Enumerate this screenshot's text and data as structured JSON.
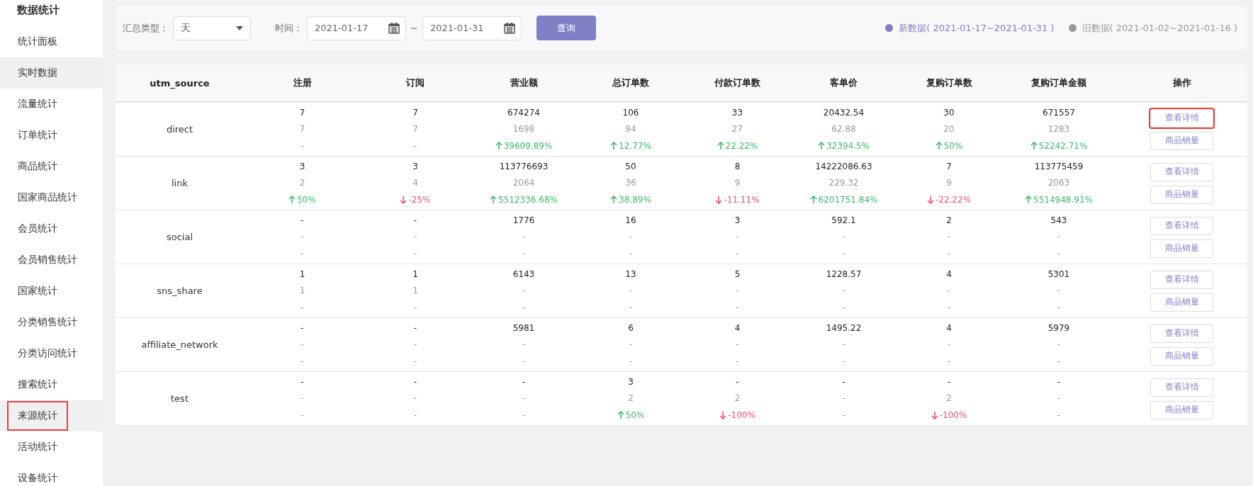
{
  "sidebar": {
    "title": "数据统计",
    "items": [
      {
        "label": "统计面板",
        "selected": false,
        "highlighted": false
      },
      {
        "label": "实时数据",
        "selected": true,
        "highlighted": false
      },
      {
        "label": "流量统计",
        "selected": false,
        "highlighted": false
      },
      {
        "label": "订单统计",
        "selected": false,
        "highlighted": false
      },
      {
        "label": "商品统计",
        "selected": false,
        "highlighted": false
      },
      {
        "label": "国家商品统计",
        "selected": false,
        "highlighted": false
      },
      {
        "label": "会员统计",
        "selected": false,
        "highlighted": false
      },
      {
        "label": "会员销售统计",
        "selected": false,
        "highlighted": false
      },
      {
        "label": "国家统计",
        "selected": false,
        "highlighted": false
      },
      {
        "label": "分类销售统计",
        "selected": false,
        "highlighted": false
      },
      {
        "label": "分类访问统计",
        "selected": false,
        "highlighted": false
      },
      {
        "label": "搜索统计",
        "selected": false,
        "highlighted": false
      },
      {
        "label": "来源统计",
        "selected": true,
        "highlighted": true
      },
      {
        "label": "活动统计",
        "selected": false,
        "highlighted": false
      },
      {
        "label": "设备统计",
        "selected": false,
        "highlighted": false
      }
    ]
  },
  "filters": {
    "type_label": "汇总类型：",
    "type_value": "天",
    "time_label": "时间：",
    "start_date": "2021-01-17",
    "separator": "~",
    "end_date": "2021-01-31",
    "query_button": "查询"
  },
  "legend": [
    {
      "name": "新数据",
      "range": "( 2021-01-17~2021-01-31 )",
      "color": "#7f7fc6"
    },
    {
      "name": "旧数据",
      "range": "( 2021-01-02~2021-01-16 )",
      "color": "#999999"
    }
  ],
  "table": {
    "columns": [
      "utm_source",
      "注册",
      "订阅",
      "营业额",
      "总订单数",
      "付款订单数",
      "客单价",
      "复购订单数",
      "复购订单金额",
      "操作"
    ],
    "rows": [
      {
        "cells": [
          {
            "kind": "source",
            "text": "direct"
          },
          {
            "kind": "metric",
            "new": "7",
            "old": "7",
            "change": {
              "kind": "flat",
              "text": "-"
            }
          },
          {
            "kind": "metric",
            "new": "7",
            "old": "7",
            "change": {
              "kind": "flat",
              "text": "-"
            }
          },
          {
            "kind": "metric",
            "new": "674274",
            "old": "1698",
            "change": {
              "kind": "up",
              "text": "39609.89%"
            }
          },
          {
            "kind": "metric",
            "new": "106",
            "old": "94",
            "change": {
              "kind": "up",
              "text": "12.77%"
            }
          },
          {
            "kind": "metric",
            "new": "33",
            "old": "27",
            "change": {
              "kind": "up",
              "text": "22.22%"
            }
          },
          {
            "kind": "metric",
            "new": "20432.54",
            "old": "62.88",
            "change": {
              "kind": "up",
              "text": "32394.5%"
            }
          },
          {
            "kind": "metric",
            "new": "30",
            "old": "20",
            "change": {
              "kind": "up",
              "text": "50%"
            }
          },
          {
            "kind": "metric",
            "new": "671557",
            "old": "1283",
            "change": {
              "kind": "up",
              "text": "52242.71%"
            }
          },
          {
            "kind": "actions",
            "buttons": [
              {
                "label": "查看详情",
                "highlighted": true
              },
              {
                "label": "商品销量",
                "highlighted": false
              }
            ]
          }
        ]
      },
      {
        "cells": [
          {
            "kind": "source",
            "text": "link"
          },
          {
            "kind": "metric",
            "new": "3",
            "old": "2",
            "change": {
              "kind": "up",
              "text": "50%"
            }
          },
          {
            "kind": "metric",
            "new": "3",
            "old": "4",
            "change": {
              "kind": "down",
              "text": "-25%"
            }
          },
          {
            "kind": "metric",
            "new": "113776693",
            "old": "2064",
            "change": {
              "kind": "up",
              "text": "5512336.68%"
            }
          },
          {
            "kind": "metric",
            "new": "50",
            "old": "36",
            "change": {
              "kind": "up",
              "text": "38.89%"
            }
          },
          {
            "kind": "metric",
            "new": "8",
            "old": "9",
            "change": {
              "kind": "down",
              "text": "-11.11%"
            }
          },
          {
            "kind": "metric",
            "new": "14222086.63",
            "old": "229.32",
            "change": {
              "kind": "up",
              "text": "6201751.84%"
            }
          },
          {
            "kind": "metric",
            "new": "7",
            "old": "9",
            "change": {
              "kind": "down",
              "text": "-22.22%"
            }
          },
          {
            "kind": "metric",
            "new": "113775459",
            "old": "2063",
            "change": {
              "kind": "up",
              "text": "5514948.91%"
            }
          },
          {
            "kind": "actions",
            "buttons": [
              {
                "label": "查看详情",
                "highlighted": false
              },
              {
                "label": "商品销量",
                "highlighted": false
              }
            ]
          }
        ]
      },
      {
        "cells": [
          {
            "kind": "source",
            "text": "social"
          },
          {
            "kind": "metric",
            "new": "-",
            "old": "-",
            "change": {
              "kind": "flat",
              "text": "-"
            }
          },
          {
            "kind": "metric",
            "new": "-",
            "old": "-",
            "change": {
              "kind": "flat",
              "text": "-"
            }
          },
          {
            "kind": "metric",
            "new": "1776",
            "old": "-",
            "change": {
              "kind": "flat",
              "text": "-"
            }
          },
          {
            "kind": "metric",
            "new": "16",
            "old": "-",
            "change": {
              "kind": "flat",
              "text": "-"
            }
          },
          {
            "kind": "metric",
            "new": "3",
            "old": "-",
            "change": {
              "kind": "flat",
              "text": "-"
            }
          },
          {
            "kind": "metric",
            "new": "592.1",
            "old": "-",
            "change": {
              "kind": "flat",
              "text": "-"
            }
          },
          {
            "kind": "metric",
            "new": "2",
            "old": "-",
            "change": {
              "kind": "flat",
              "text": "-"
            }
          },
          {
            "kind": "metric",
            "new": "543",
            "old": "-",
            "change": {
              "kind": "flat",
              "text": "-"
            }
          },
          {
            "kind": "actions",
            "buttons": [
              {
                "label": "查看详情",
                "highlighted": false
              },
              {
                "label": "商品销量",
                "highlighted": false
              }
            ]
          }
        ]
      },
      {
        "cells": [
          {
            "kind": "source",
            "text": "sns_share"
          },
          {
            "kind": "metric",
            "new": "1",
            "old": "1",
            "change": {
              "kind": "flat",
              "text": "-"
            }
          },
          {
            "kind": "metric",
            "new": "1",
            "old": "1",
            "change": {
              "kind": "flat",
              "text": "-"
            }
          },
          {
            "kind": "metric",
            "new": "6143",
            "old": "-",
            "change": {
              "kind": "flat",
              "text": "-"
            }
          },
          {
            "kind": "metric",
            "new": "13",
            "old": "-",
            "change": {
              "kind": "flat",
              "text": "-"
            }
          },
          {
            "kind": "metric",
            "new": "5",
            "old": "-",
            "change": {
              "kind": "flat",
              "text": "-"
            }
          },
          {
            "kind": "metric",
            "new": "1228.57",
            "old": "-",
            "change": {
              "kind": "flat",
              "text": "-"
            }
          },
          {
            "kind": "metric",
            "new": "4",
            "old": "-",
            "change": {
              "kind": "flat",
              "text": "-"
            }
          },
          {
            "kind": "metric",
            "new": "5301",
            "old": "-",
            "change": {
              "kind": "flat",
              "text": "-"
            }
          },
          {
            "kind": "actions",
            "buttons": [
              {
                "label": "查看详情",
                "highlighted": false
              },
              {
                "label": "商品销量",
                "highlighted": false
              }
            ]
          }
        ]
      },
      {
        "cells": [
          {
            "kind": "source",
            "text": "affiliate_network"
          },
          {
            "kind": "metric",
            "new": "-",
            "old": "-",
            "change": {
              "kind": "flat",
              "text": "-"
            }
          },
          {
            "kind": "metric",
            "new": "-",
            "old": "-",
            "change": {
              "kind": "flat",
              "text": "-"
            }
          },
          {
            "kind": "metric",
            "new": "5981",
            "old": "-",
            "change": {
              "kind": "flat",
              "text": "-"
            }
          },
          {
            "kind": "metric",
            "new": "6",
            "old": "-",
            "change": {
              "kind": "flat",
              "text": "-"
            }
          },
          {
            "kind": "metric",
            "new": "4",
            "old": "-",
            "change": {
              "kind": "flat",
              "text": "-"
            }
          },
          {
            "kind": "metric",
            "new": "1495.22",
            "old": "-",
            "change": {
              "kind": "flat",
              "text": "-"
            }
          },
          {
            "kind": "metric",
            "new": "4",
            "old": "-",
            "change": {
              "kind": "flat",
              "text": "-"
            }
          },
          {
            "kind": "metric",
            "new": "5979",
            "old": "-",
            "change": {
              "kind": "flat",
              "text": "-"
            }
          },
          {
            "kind": "actions",
            "buttons": [
              {
                "label": "查看详情",
                "highlighted": false
              },
              {
                "label": "商品销量",
                "highlighted": false
              }
            ]
          }
        ]
      },
      {
        "cells": [
          {
            "kind": "source",
            "text": "test"
          },
          {
            "kind": "metric",
            "new": "-",
            "old": "-",
            "change": {
              "kind": "flat",
              "text": "-"
            }
          },
          {
            "kind": "metric",
            "new": "-",
            "old": "-",
            "change": {
              "kind": "flat",
              "text": "-"
            }
          },
          {
            "kind": "metric",
            "new": "-",
            "old": "-",
            "change": {
              "kind": "flat",
              "text": "-"
            }
          },
          {
            "kind": "metric",
            "new": "3",
            "old": "2",
            "change": {
              "kind": "up",
              "text": "50%"
            }
          },
          {
            "kind": "metric",
            "new": "-",
            "old": "2",
            "change": {
              "kind": "down",
              "text": "-100%"
            }
          },
          {
            "kind": "metric",
            "new": "-",
            "old": "-",
            "change": {
              "kind": "flat",
              "text": "-"
            }
          },
          {
            "kind": "metric",
            "new": "-",
            "old": "2",
            "change": {
              "kind": "down",
              "text": "-100%"
            }
          },
          {
            "kind": "metric",
            "new": "-",
            "old": "-",
            "change": {
              "kind": "flat",
              "text": "-"
            }
          },
          {
            "kind": "actions",
            "buttons": [
              {
                "label": "查看详情",
                "highlighted": false
              },
              {
                "label": "商品销量",
                "highlighted": false
              }
            ]
          }
        ]
      }
    ]
  }
}
